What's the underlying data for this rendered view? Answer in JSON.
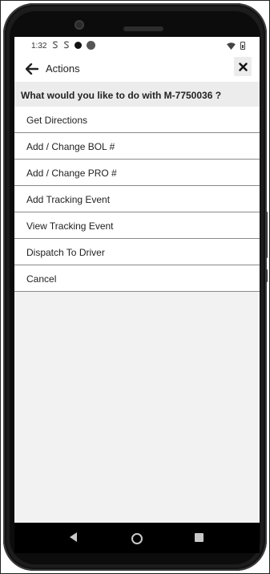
{
  "status_bar": {
    "time": "1:32",
    "icons": [
      "s-notification-icon",
      "s-notification-icon",
      "black-dot-icon",
      "grey-dot-icon",
      "wifi-icon",
      "battery-icon"
    ]
  },
  "app_bar": {
    "title": "Actions",
    "back_icon": "arrow-left-icon",
    "close_icon": "close-x-icon"
  },
  "prompt": {
    "text": "What would you like to do with M-7750036 ?"
  },
  "actions": [
    {
      "label": "Get Directions"
    },
    {
      "label": "Add / Change BOL #"
    },
    {
      "label": "Add / Change PRO #"
    },
    {
      "label": "Add Tracking Event"
    },
    {
      "label": "View Tracking Event"
    },
    {
      "label": "Dispatch To Driver"
    },
    {
      "label": "Cancel"
    }
  ],
  "colors": {
    "screen_bg": "#f2f2f2",
    "prompt_bg": "#ececec",
    "divider": "#8a8a8a",
    "phone_body": "#1c1c1c"
  }
}
